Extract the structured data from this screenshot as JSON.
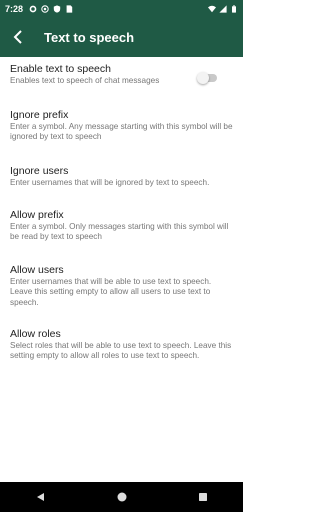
{
  "status_bar": {
    "time": "7:28",
    "left_icons": [
      "settings-icon",
      "at-sign-icon",
      "shield-icon",
      "sim-icon"
    ],
    "right_icons": [
      "wifi-icon",
      "signal-icon",
      "battery-icon"
    ]
  },
  "app_bar": {
    "title": "Text to speech",
    "back_icon": "back-arrow-icon",
    "background": "#1f5a45"
  },
  "settings": [
    {
      "title": "Enable text to speech",
      "summary": "Enables text to speech of chat messages",
      "toggle": false
    },
    {
      "title": "Ignore prefix",
      "summary": "Enter a symbol. Any message starting with this symbol will be ignored by text to speech"
    },
    {
      "title": "Ignore users",
      "summary": "Enter usernames that will be ignored by text to speech."
    },
    {
      "title": "Allow prefix",
      "summary": "Enter a symbol. Only messages starting with this symbol will be read by text to speech"
    },
    {
      "title": "Allow users",
      "summary": "Enter usernames that will be able to use text to speech. Leave this setting empty to allow all users to use text to speech."
    },
    {
      "title": "Allow roles",
      "summary": "Select roles that will be able to use text to speech. Leave this setting empty to allow all roles to use text to speech."
    }
  ],
  "nav_bar": {
    "icons": [
      "back-triangle-icon",
      "home-circle-icon",
      "recents-square-icon"
    ]
  }
}
